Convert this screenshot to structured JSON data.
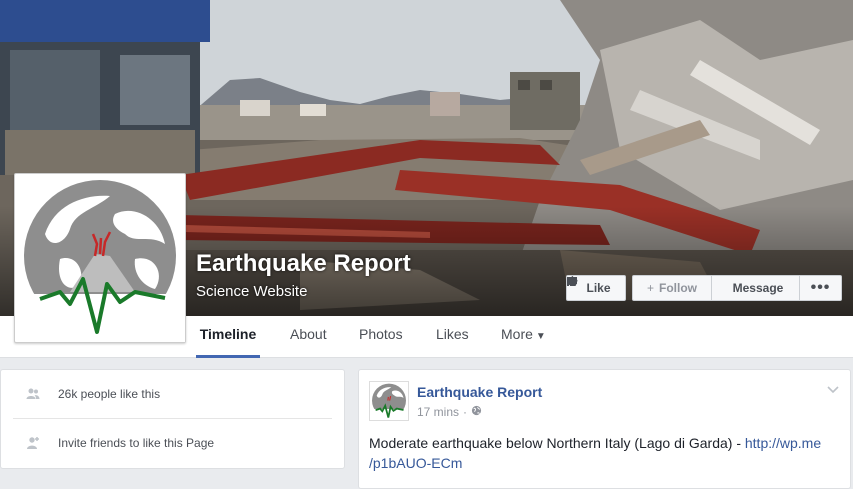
{
  "page": {
    "name": "Earthquake Report",
    "category": "Science Website"
  },
  "actions": {
    "like": "Like",
    "follow": "Follow",
    "message": "Message",
    "more": "•••"
  },
  "nav": {
    "tabs": [
      "Timeline",
      "About",
      "Photos",
      "Likes",
      "More"
    ],
    "active": "Timeline"
  },
  "sidebar": {
    "likes_text": "26k people like this",
    "invite_text": "Invite friends to like this Page"
  },
  "post": {
    "author": "Earthquake Report",
    "time": "17 mins",
    "separator": "·",
    "text": "Moderate earthquake below Northern Italy (Lago di Garda) - ",
    "link_line1": "http://wp.me",
    "link_line2": "/p1bAUO-ECm"
  },
  "colors": {
    "link": "#365899",
    "accent": "#4267b2",
    "logo_gray": "#888888",
    "logo_green": "#1a7a2a",
    "logo_red": "#c62828",
    "beam_red": "#8b2a22"
  },
  "icons": {
    "like": "thumbs-up-icon",
    "follow": "plus-icon",
    "message": "message-icon",
    "privacy": "globe-icon",
    "likes": "people-icon",
    "invite": "add-person-icon",
    "post_menu": "chevron-down-icon"
  }
}
